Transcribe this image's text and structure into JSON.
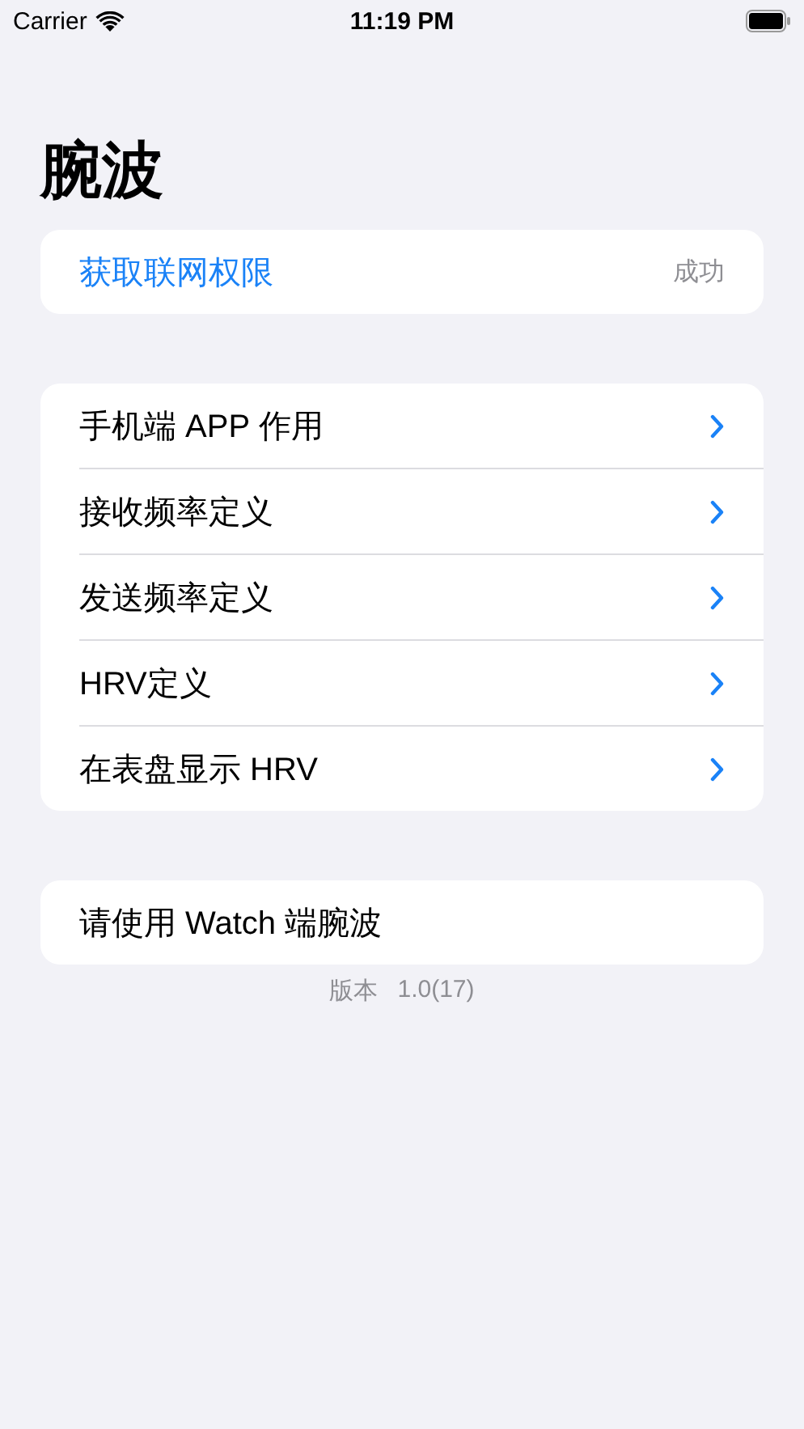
{
  "status_bar": {
    "carrier": "Carrier",
    "time": "11:19 PM"
  },
  "title": "腕波",
  "permission": {
    "label": "获取联网权限",
    "status": "成功"
  },
  "menu": [
    {
      "label": "手机端 APP 作用"
    },
    {
      "label": "接收频率定义"
    },
    {
      "label": "发送频率定义"
    },
    {
      "label": "HRV定义"
    },
    {
      "label": "在表盘显示 HRV"
    }
  ],
  "watch_note": "请使用 Watch 端腕波",
  "version": {
    "label": "版本",
    "number": "1.0(17)"
  }
}
